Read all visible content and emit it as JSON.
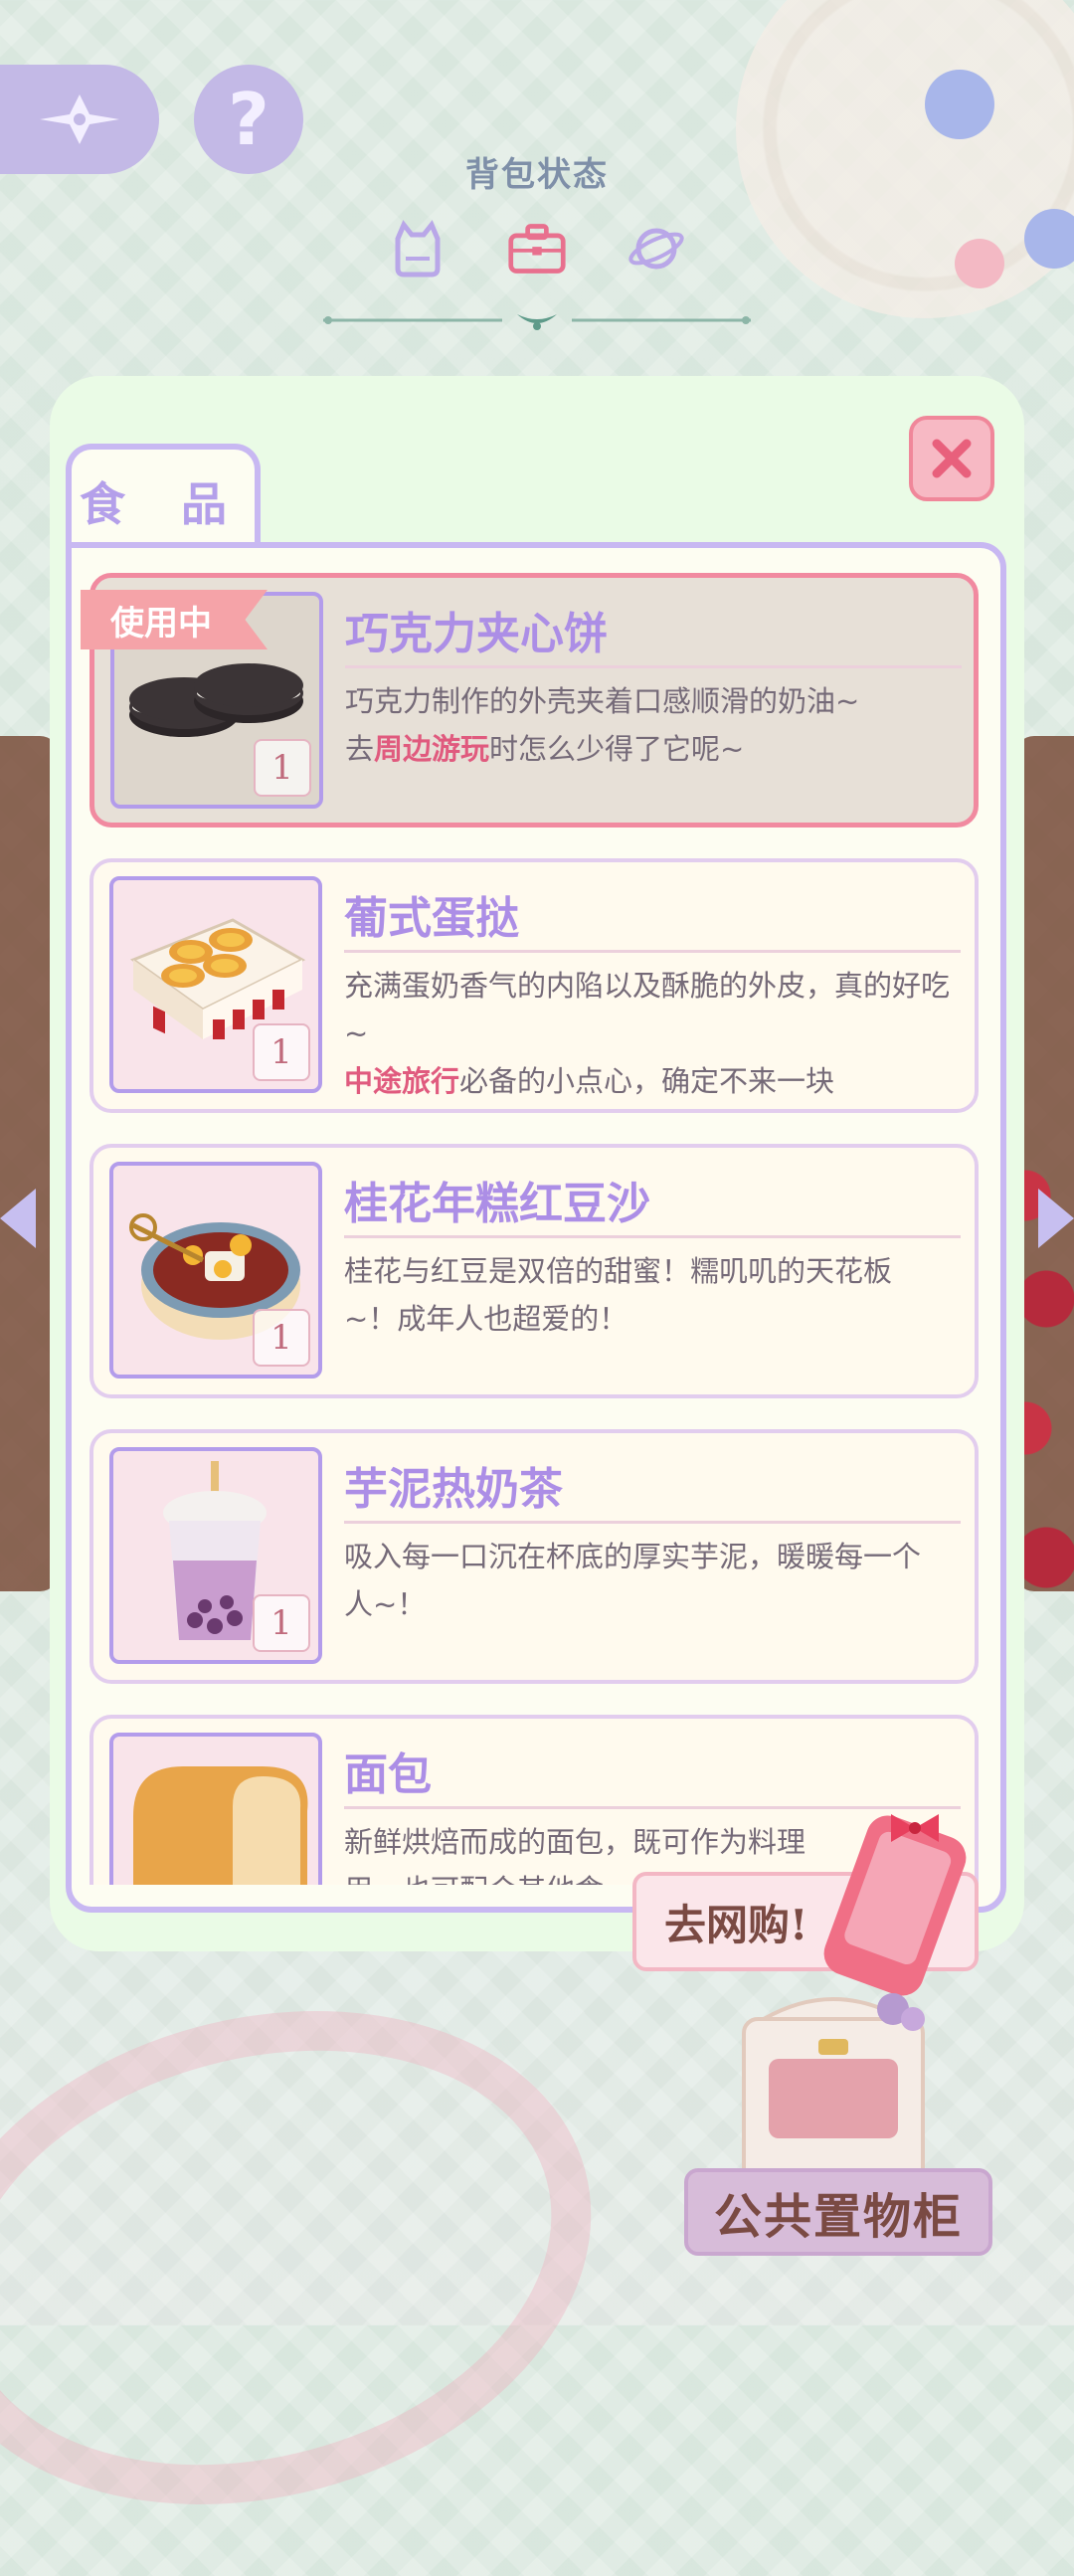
{
  "header": {
    "title": "背包状态",
    "tabs": [
      {
        "icon": "cat-bag-icon"
      },
      {
        "icon": "briefcase-icon",
        "active": true
      },
      {
        "icon": "planet-icon"
      }
    ]
  },
  "category_tab": "食 品",
  "items": [
    {
      "name": "巧克力夹心饼",
      "desc_parts": [
        {
          "text": "巧克力制作的外壳夹着口感顺滑的奶油",
          "hl": false
        },
        {
          "text": "~",
          "hl": false
        },
        {
          "text": "去",
          "hl": false
        },
        {
          "text": "周边游玩",
          "hl": true
        },
        {
          "text": "时怎么少得了它呢~",
          "hl": false
        }
      ],
      "qty": "1",
      "badge": "使用中",
      "active": true,
      "image": "oreo-cookies"
    },
    {
      "name": "葡式蛋挞",
      "desc_parts": [
        {
          "text": "充满蛋奶香气的内陷以及酥脆的外皮，真的好吃~",
          "hl": false
        },
        {
          "text": "中途旅行",
          "hl": true
        },
        {
          "text": "必备的小点心，确定不来一块",
          "hl": false
        }
      ],
      "qty": "1",
      "image": "egg-tarts"
    },
    {
      "name": "桂花年糕红豆沙",
      "desc_parts": [
        {
          "text": "桂花与红豆是双倍的甜蜜！糯叽叽的天花板~！成年人也超爱的！",
          "hl": false
        }
      ],
      "qty": "1",
      "image": "red-bean-soup"
    },
    {
      "name": "芋泥热奶茶",
      "desc_parts": [
        {
          "text": "吸入每一口沉在杯底的厚实芋泥，暖暖每一个人~！",
          "hl": false
        }
      ],
      "qty": "1",
      "image": "taro-milk-tea"
    },
    {
      "name": "面包",
      "desc_parts": [
        {
          "text": "新鲜烘焙而成的面包，既可作为料理",
          "hl": false
        },
        {
          "text": "用，也可配合其他食",
          "hl": false
        }
      ],
      "qty": "",
      "image": "bread-loaf"
    }
  ],
  "shop_button": "去网购!",
  "cabinet_label": "公共置物柜",
  "colors": {
    "accent": "#ac8ee6",
    "highlight": "#e05a7e",
    "panel": "#eafbe6",
    "frame": "#c8b8f2"
  }
}
